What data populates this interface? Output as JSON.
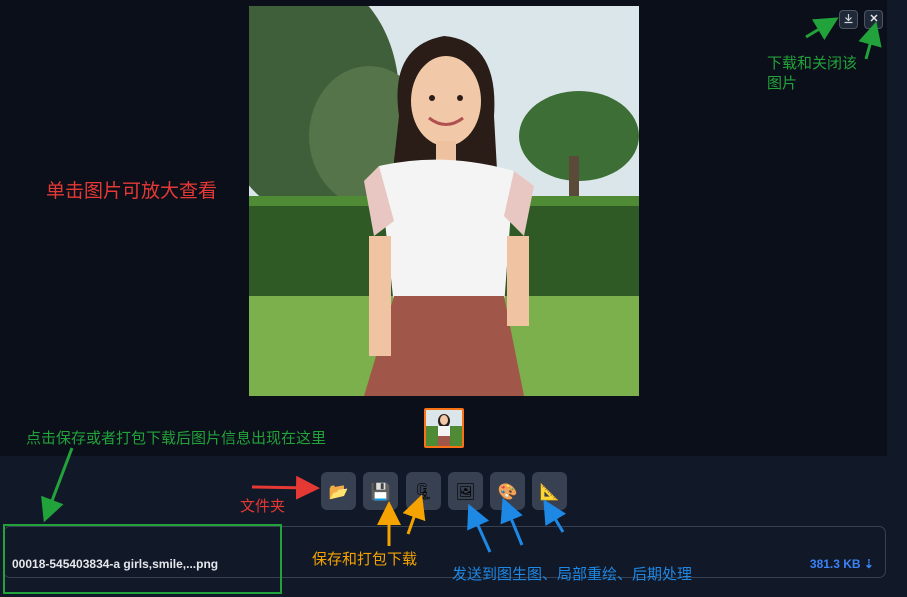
{
  "gallery": {
    "download_icon": "download-icon",
    "close_icon": "close-icon"
  },
  "toolbar": [
    {
      "name": "open-folder-button",
      "icon": "📂"
    },
    {
      "name": "save-button",
      "icon": "💾"
    },
    {
      "name": "zip-download-button",
      "icon": "🗜"
    },
    {
      "name": "send-to-img2img-button",
      "icon": "🖼"
    },
    {
      "name": "send-to-inpaint-button",
      "icon": "🎨"
    },
    {
      "name": "send-to-extras-button",
      "icon": "📐"
    }
  ],
  "info": {
    "filename": "00018-545403834-a girls,smile,...png",
    "filesize": "381.3 KB ⇣"
  },
  "annotations": {
    "download_close": "下载和关闭该",
    "download_close_line2": "图片",
    "click_enlarge": "单击图片可放大查看",
    "info_appears": "点击保存或者打包下载后图片信息出现在这里",
    "folder": "文件夹",
    "save_zip": "保存和打包下载",
    "send_to": "发送到图生图、局部重绘、后期处理"
  },
  "colors": {
    "annotation_green": "#22a23a",
    "annotation_red": "#e53935",
    "annotation_orange": "#f5a300",
    "annotation_blue": "#1e88e5"
  }
}
